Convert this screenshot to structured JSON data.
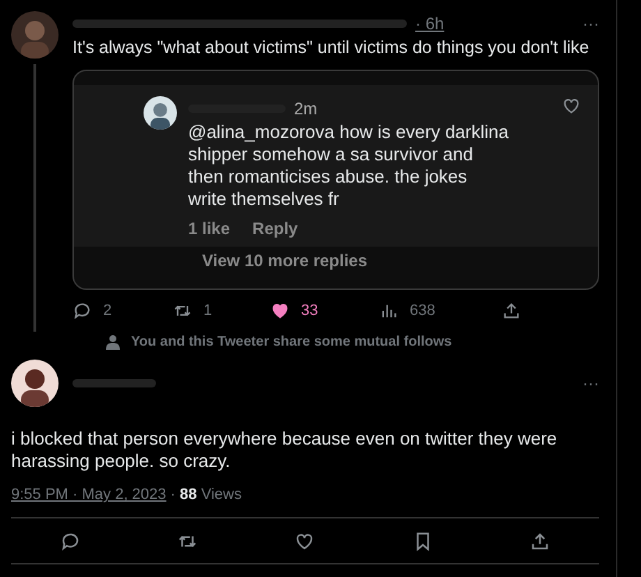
{
  "tweet": {
    "time": "· 6h",
    "text": "It's always \"what about victims\" until victims do things you don't like",
    "more": "···",
    "card": {
      "comment": {
        "time": "2m",
        "text": "@alina_mozorova how is every darklina shipper somehow a sa survivor and then romanticises abuse. the jokes write themselves fr",
        "likes": "1 like",
        "reply": "Reply"
      },
      "view_more": "View 10 more replies"
    },
    "actions": [
      {
        "kind": "reply",
        "count": "2",
        "active": false
      },
      {
        "kind": "retweet",
        "count": "1",
        "active": false
      },
      {
        "kind": "like",
        "count": "33",
        "active": true
      },
      {
        "kind": "views",
        "count": "638",
        "active": false
      },
      {
        "kind": "share",
        "active": false
      }
    ]
  },
  "mutual": "You and this Tweeter share some mutual follows",
  "reply_tweet": {
    "more": "···",
    "text": "i blocked that person everywhere because even on twitter they were harassing people. so crazy.",
    "timestamp": "9:55 PM · May 2, 2023",
    "separator": "·",
    "views_count": "88",
    "views_label": "Views",
    "actions": [
      {
        "kind": "reply",
        "active": false
      },
      {
        "kind": "retweet",
        "active": false
      },
      {
        "kind": "like",
        "active": false
      },
      {
        "kind": "bookmark",
        "active": false
      },
      {
        "kind": "share",
        "active": false
      }
    ]
  }
}
